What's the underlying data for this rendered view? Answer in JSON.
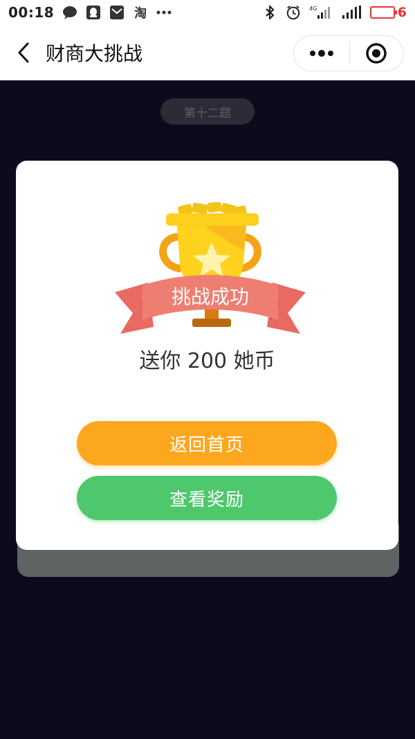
{
  "status_bar": {
    "time": "00:18",
    "network": "4G",
    "battery_level": "6",
    "left_icons": [
      "chat-bubble-icon",
      "qq-icon",
      "mail-icon",
      "taobao-icon",
      "more-dots-icon"
    ],
    "right_icons": [
      "bluetooth-icon",
      "alarm-icon",
      "signal-4g-icon",
      "signal-icon",
      "battery-icon"
    ],
    "taobao_glyph": "淘"
  },
  "nav": {
    "title": "财商大挑战",
    "back_icon": "chevron-left-icon",
    "more_icon": "more-dots-icon",
    "close_icon": "target-icon"
  },
  "main": {
    "question_label": "第十二题"
  },
  "result_card": {
    "banner_text": "挑战成功",
    "reward_text": "送你 200 她币",
    "buttons": {
      "home_label": "返回首页",
      "reward_label": "查看奖励"
    }
  },
  "colors": {
    "background": "#0c0b1e",
    "home_button": "#fda71e",
    "reward_button": "#4fc76c",
    "battery": "#ee3333",
    "banner": "#ef7e72",
    "trophy": "#ffd21f"
  }
}
